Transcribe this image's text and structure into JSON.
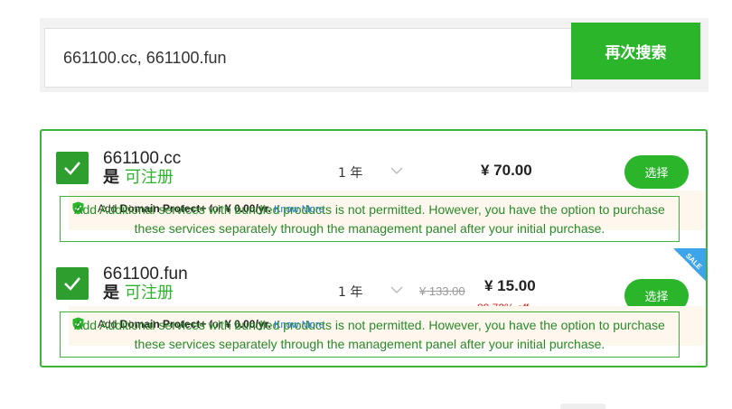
{
  "search": {
    "value": "661100.cc, 661100.fun",
    "button_label": "再次搜索"
  },
  "results": [
    {
      "domain": "661100.cc",
      "available_prefix": "是",
      "available_text": "可注册",
      "period": "1 年",
      "price": "¥ 70.00",
      "select_label": "选择",
      "addon_prefix": "Add",
      "addon_name": "Domain Protect+",
      "addon_for": "for",
      "addon_price": "¥ 0.00/yr.",
      "addon_link": "Know More",
      "notice": "Add Additional services with bundled products is not permitted. However, you have the option to purchase these services separately through the management panel after your initial purchase."
    },
    {
      "domain": "661100.fun",
      "available_prefix": "是",
      "available_text": "可注册",
      "period": "1 年",
      "old_price": "¥ 133.00",
      "price": "¥ 15.00",
      "discount": "88.72% off",
      "sale_badge": "SALE",
      "select_label": "选择",
      "addon_prefix": "Add",
      "addon_name": "Domain Protect+",
      "addon_for": "for",
      "addon_price": "¥ 0.00/yr.",
      "addon_link": "Know More",
      "notice": "Add Additional services with bundled products is not permitted. However, you have the option to purchase these services separately through the management panel after your initial purchase."
    }
  ],
  "colors": {
    "accent": "#2bb52b",
    "checkbox": "#2e9e2e",
    "discount": "#e02020",
    "sale_badge": "#3da3ea"
  }
}
